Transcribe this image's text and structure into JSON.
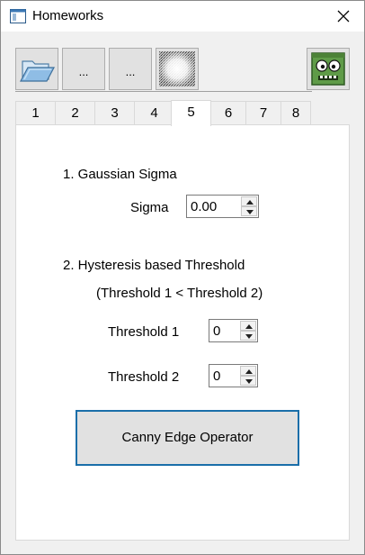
{
  "window": {
    "title": "Homeworks"
  },
  "icons": {
    "app": "window-app-icon",
    "close": "close-icon",
    "open": "folder-open-icon",
    "noise": "noise-image-icon",
    "zombie": "zombie-face-icon"
  },
  "toolbar": {
    "button2_label": "...",
    "button3_label": "..."
  },
  "tabs": [
    "1",
    "2",
    "3",
    "4",
    "5",
    "6",
    "7",
    "8"
  ],
  "active_tab": "5",
  "panel": {
    "section1_label": "1. Gaussian Sigma",
    "sigma_label": "Sigma",
    "sigma_value": "0.00",
    "section2_label": "2. Hysteresis based Threshold",
    "threshold_note": "(Threshold 1 < Threshold 2)",
    "threshold1_label": "Threshold 1",
    "threshold1_value": "0",
    "threshold2_label": "Threshold 2",
    "threshold2_value": "0",
    "canny_button_label": "Canny Edge Operator"
  },
  "colors": {
    "focus_border": "#1a6ea9",
    "button_face": "#e1e1e1"
  }
}
